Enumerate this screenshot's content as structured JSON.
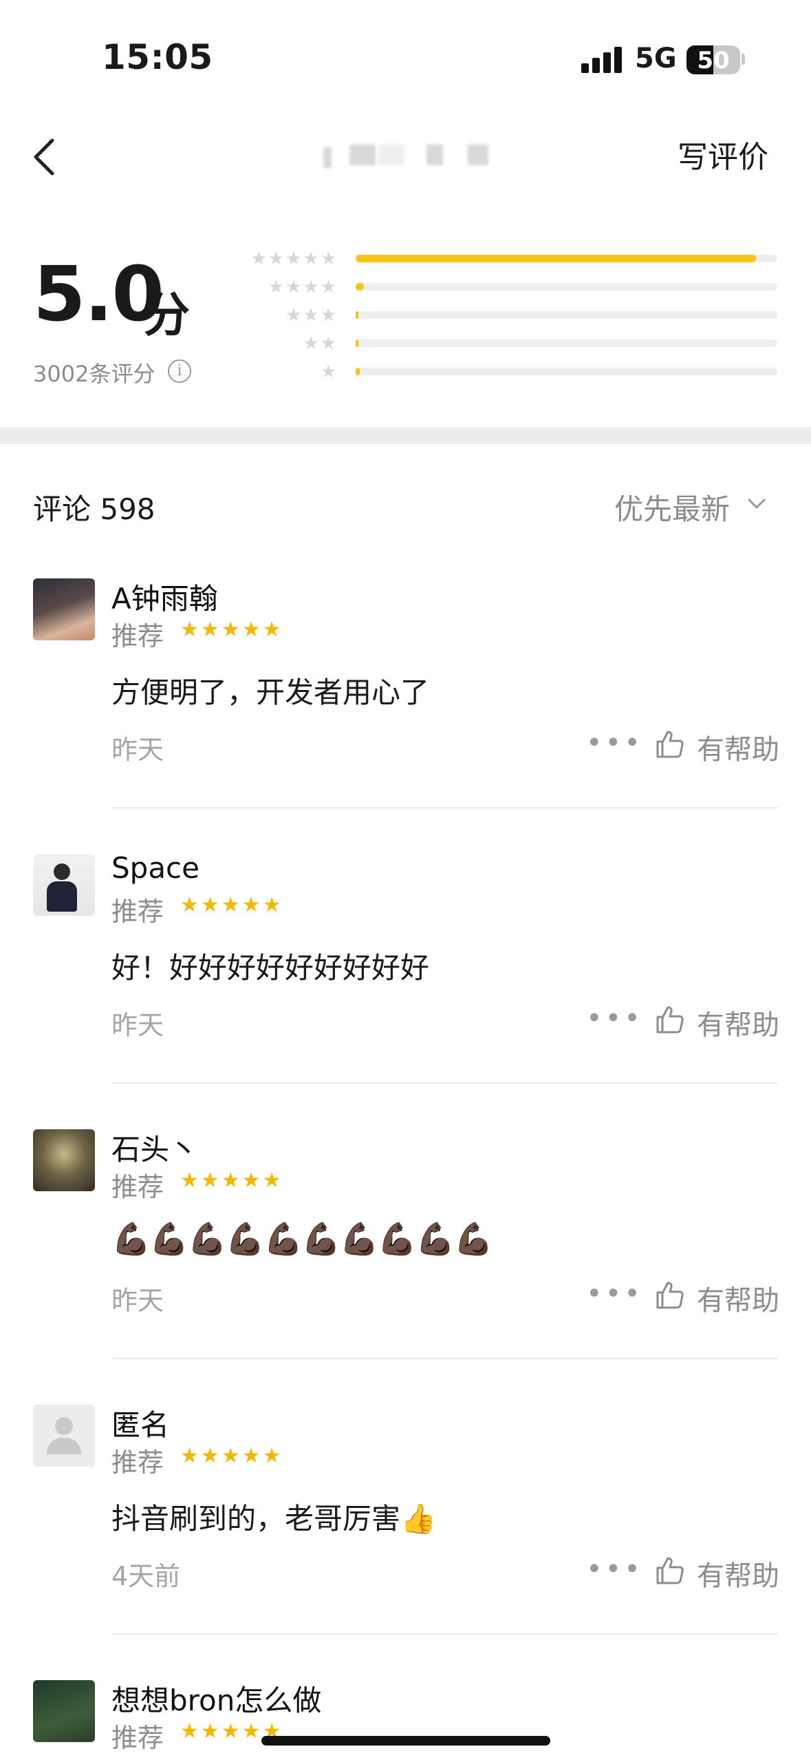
{
  "status_bar": {
    "time": "15:05",
    "network": "5G",
    "battery": "50"
  },
  "nav": {
    "write_review": "写评价"
  },
  "summary": {
    "score": "5.0",
    "score_unit": "分",
    "rating_count": "3002条评分",
    "distribution": [
      {
        "stars": 5,
        "fraction": 0.95
      },
      {
        "stars": 4,
        "fraction": 0.02
      },
      {
        "stars": 3,
        "fraction": 0.005
      },
      {
        "stars": 2,
        "fraction": 0.003
      },
      {
        "stars": 1,
        "fraction": 0.01
      }
    ]
  },
  "comments": {
    "title": "评论 598",
    "sort": "优先最新"
  },
  "reviews": [
    {
      "user": "A钟雨翰",
      "tag": "推荐",
      "stars": "★★★★★",
      "text": "方便明了，开发者用心了",
      "date": "昨天",
      "more": "•••",
      "helpful": "有帮助"
    },
    {
      "user": "Space",
      "tag": "推荐",
      "stars": "★★★★★",
      "text": "好！好好好好好好好好好",
      "date": "昨天",
      "more": "•••",
      "helpful": "有帮助"
    },
    {
      "user": "石头丶",
      "tag": "推荐",
      "stars": "★★★★★",
      "text": "💪🏿💪🏿💪🏿💪🏿💪🏿💪🏿💪🏿💪🏿💪🏿💪🏿",
      "date": "昨天",
      "more": "•••",
      "helpful": "有帮助"
    },
    {
      "user": "匿名",
      "tag": "推荐",
      "stars": "★★★★★",
      "text": "抖音刷到的，老哥厉害👍",
      "date": "4天前",
      "more": "•••",
      "helpful": "有帮助"
    },
    {
      "user": "想想bron怎么做",
      "tag": "推荐",
      "stars": "★★★★★"
    }
  ],
  "colors": {
    "accent": "#f5c518",
    "star": "#f5b800",
    "muted": "#8c8c8c"
  }
}
